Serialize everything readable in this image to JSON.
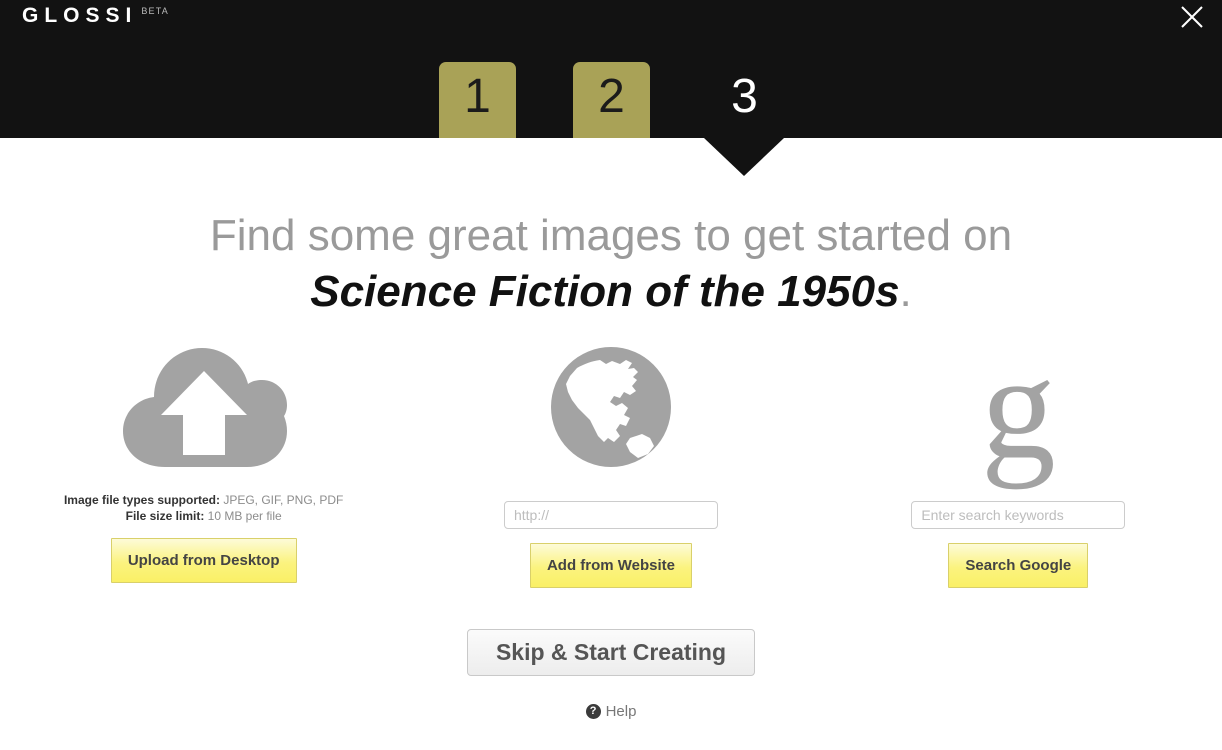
{
  "app": {
    "logo_word": "GLOSSI",
    "logo_badge": "BETA",
    "close_icon": "close-icon"
  },
  "steps": {
    "items": [
      {
        "label": "1",
        "state": "done"
      },
      {
        "label": "2",
        "state": "done"
      },
      {
        "label": "3",
        "state": "current"
      }
    ]
  },
  "headline": {
    "lead": "Find some great images to get started on",
    "topic": "Science Fiction of the 1950s",
    "period": "."
  },
  "columns": {
    "upload": {
      "icon": "cloud-upload-icon",
      "file_types_label": "Image file types supported:",
      "file_types_value": " JPEG, GIF, PNG, PDF",
      "file_size_label": "File size limit:",
      "file_size_value": " 10 MB per file",
      "button_label": "Upload from Desktop"
    },
    "website": {
      "icon": "globe-icon",
      "input_placeholder": "http://",
      "input_value": "",
      "button_label": "Add from Website"
    },
    "google": {
      "icon": "google-g-icon",
      "input_placeholder": "Enter search keywords",
      "input_value": "",
      "button_label": "Search Google"
    }
  },
  "footer": {
    "skip_label": "Skip & Start Creating",
    "help_icon_glyph": "?",
    "help_label": "Help"
  },
  "colors": {
    "step_done": "#a9a257",
    "header_bg": "#121212",
    "button_yellow": "#faf066",
    "icon_gray": "#a3a3a3"
  }
}
